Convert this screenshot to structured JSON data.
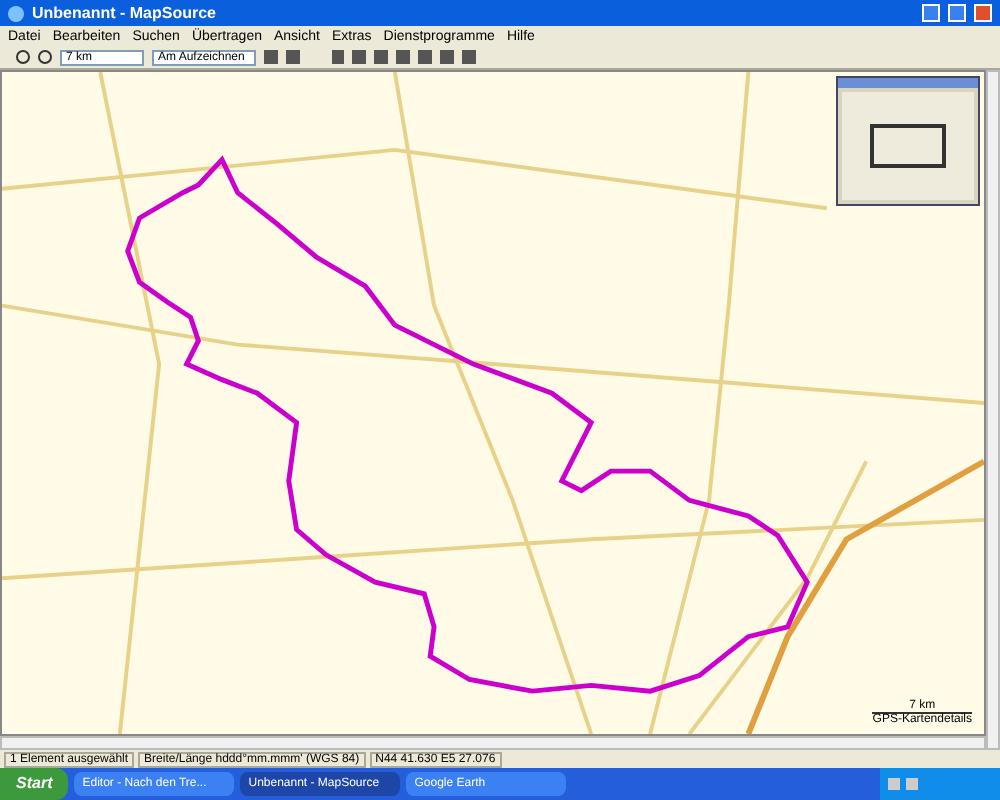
{
  "window": {
    "title": "Unbenannt - MapSource"
  },
  "menu": [
    "Datei",
    "Bearbeiten",
    "Suchen",
    "Übertragen",
    "Ansicht",
    "Extras",
    "Dienstprogramme",
    "Hilfe"
  ],
  "toolbar": {
    "zoom_select": "7 km",
    "mode_select": "Am Aufzeichnen"
  },
  "map": {
    "scale": "7 km",
    "detail_label": "GPS-Kartendetails"
  },
  "status_bar": [
    "1 Element ausgewählt",
    "Breite/Länge hddd°mm.mmm' (WGS 84)",
    "N44 41.630 E5 27.076"
  ],
  "taskbar": {
    "start": "Start",
    "tasks": [
      {
        "label": "Editor - Nach den Tre...",
        "selected": false
      },
      {
        "label": "Unbenannt - MapSource",
        "selected": true
      },
      {
        "label": "Google Earth",
        "selected": false
      }
    ]
  }
}
